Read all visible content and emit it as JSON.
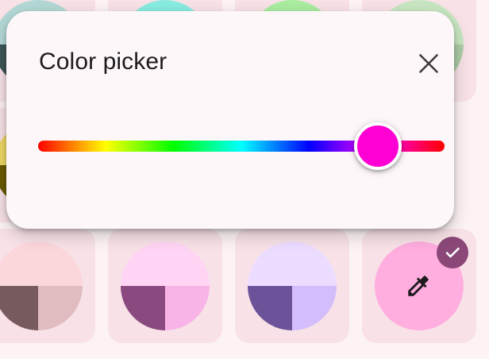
{
  "dialog": {
    "title": "Color picker",
    "close_icon": "close-icon"
  },
  "hue_slider": {
    "value_deg": 301,
    "min_deg": 0,
    "max_deg": 360,
    "thumb_color": "#ff00d4"
  },
  "swatches": [
    {
      "name": "teal-gray",
      "top": "#b3d8d6",
      "bottom_left": "#3f5656",
      "bottom_right": "#8ab0ae"
    },
    {
      "name": "cyan",
      "top": "#88ece0",
      "bottom_left": "#006b63",
      "bottom_right": "#6fd5c8"
    },
    {
      "name": "green",
      "top": "#a9eda0",
      "bottom_left": "#2b6a27",
      "bottom_right": "#8fd486"
    },
    {
      "name": "sage",
      "top": "#c8e6c2",
      "bottom_left": "#4d6647",
      "bottom_right": "#aecda8"
    },
    {
      "name": "yellow",
      "top": "#efd866",
      "bottom_left": "#6b5a00",
      "bottom_right": "#d4bf4e"
    },
    {
      "name": "rose-gray",
      "top": "#fbd7dc",
      "bottom_left": "#775a5e",
      "bottom_right": "#e0bcc0"
    },
    {
      "name": "orchid",
      "top": "#ffd4f4",
      "bottom_left": "#8a4a80",
      "bottom_right": "#f8b3e7"
    },
    {
      "name": "lavender",
      "top": "#ecdcff",
      "bottom_left": "#6c5399",
      "bottom_right": "#d3bdfa"
    }
  ],
  "custom_color": {
    "color": "#ffaedf",
    "icon": "eyedropper-icon",
    "selected": true,
    "selected_icon": "check-icon"
  },
  "colors": {
    "tile_bg": "#f8e2e7",
    "dialog_bg": "#fdf7fa",
    "badge_bg": "#8a4777"
  }
}
